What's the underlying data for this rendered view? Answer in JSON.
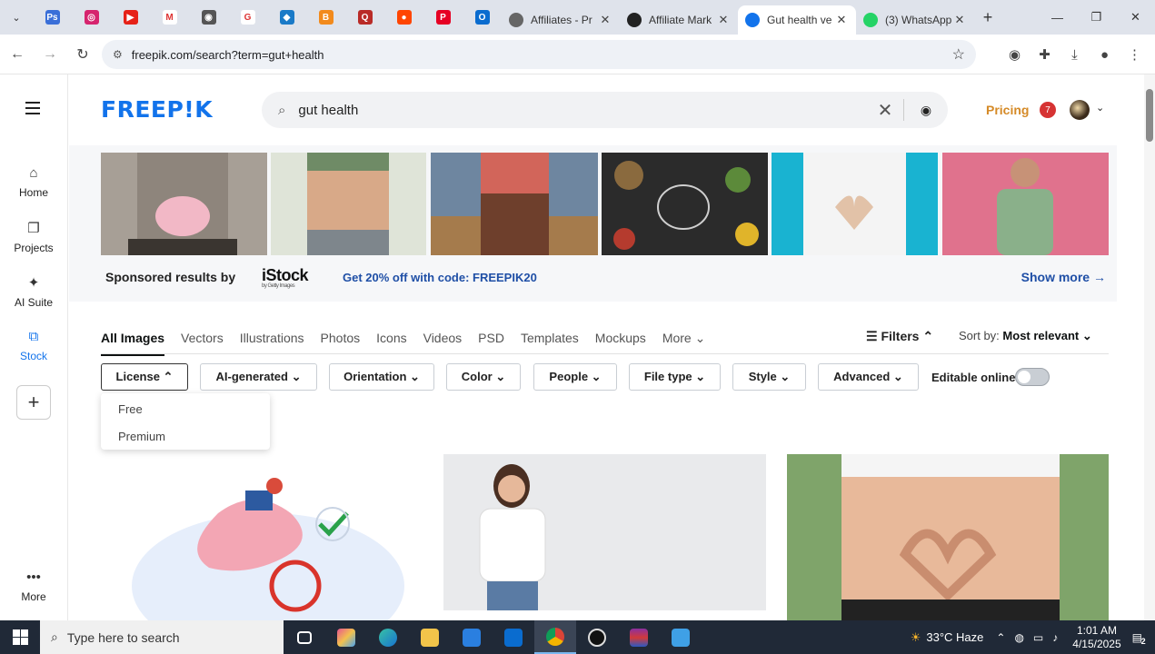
{
  "browser": {
    "pinned_tabs": [
      {
        "name": "tab-pinned-1",
        "color": "#3a6fd8",
        "glyph": "Ps"
      },
      {
        "name": "tab-pinned-instagram",
        "color": "#d6246e",
        "glyph": "◎"
      },
      {
        "name": "tab-pinned-youtube",
        "color": "#e62117",
        "glyph": "▶"
      },
      {
        "name": "tab-pinned-gmail",
        "color": "#ffffff",
        "glyph": "M"
      },
      {
        "name": "tab-pinned-5",
        "color": "#555555",
        "glyph": "◉"
      },
      {
        "name": "tab-pinned-google",
        "color": "#ffffff",
        "glyph": "G"
      },
      {
        "name": "tab-pinned-7",
        "color": "#1a7ac7",
        "glyph": "◆"
      },
      {
        "name": "tab-pinned-blogger",
        "color": "#f28a1c",
        "glyph": "B"
      },
      {
        "name": "tab-pinned-quora",
        "color": "#b92b27",
        "glyph": "Q"
      },
      {
        "name": "tab-pinned-reddit",
        "color": "#ff4500",
        "glyph": "●"
      },
      {
        "name": "tab-pinned-pinterest",
        "color": "#e60023",
        "glyph": "P"
      },
      {
        "name": "tab-pinned-outlook",
        "color": "#0a6ccf",
        "glyph": "O"
      }
    ],
    "tabs": [
      {
        "label": "Affiliates - Pr",
        "icon_color": "#666666",
        "active": false
      },
      {
        "label": "Affiliate Mark",
        "icon_color": "#222222",
        "active": false
      },
      {
        "label": "Gut health ve",
        "icon_color": "#1273eb",
        "active": true
      },
      {
        "label": "(3) WhatsApp",
        "icon_color": "#25d366",
        "active": false
      }
    ],
    "url": "freepik.com/search?term=gut+health"
  },
  "sidebar": {
    "items": [
      {
        "label": "Home",
        "icon": "home-icon",
        "glyph": "⌂"
      },
      {
        "label": "Projects",
        "icon": "folder-icon",
        "glyph": "❐"
      },
      {
        "label": "AI Suite",
        "icon": "sparkle-icon",
        "glyph": "✦"
      },
      {
        "label": "Stock",
        "icon": "stock-icon",
        "glyph": "⧉"
      }
    ],
    "more_label": "More"
  },
  "header": {
    "logo": "FREEP!K",
    "search_value": "gut health",
    "pricing": "Pricing",
    "notification_count": "7"
  },
  "sponsored": {
    "label": "Sponsored results by",
    "brand": "iStock",
    "brand_sub": "by Getty Images",
    "promo": "Get 20% off with code: FREEPIK20",
    "show_more": "Show more →"
  },
  "content_tabs": [
    "All Images",
    "Vectors",
    "Illustrations",
    "Photos",
    "Icons",
    "Videos",
    "PSD",
    "Templates",
    "Mockups",
    "More ⌄"
  ],
  "filters_label": "Filters ⌃",
  "sort": {
    "prefix": "Sort by:",
    "value": "Most relevant ⌄"
  },
  "filter_pills": [
    "License ⌃",
    "AI-generated ⌄",
    "Orientation ⌄",
    "Color ⌄",
    "People ⌄",
    "File type ⌄",
    "Style ⌄",
    "Advanced ⌄"
  ],
  "editable_online": "Editable online",
  "license_options": [
    "Free",
    "Premium"
  ],
  "taskbar": {
    "search_placeholder": "Type here to search",
    "weather": "33°C  Haze",
    "time": "1:01 AM",
    "date": "4/15/2025",
    "notification_count": "2"
  },
  "colors": {
    "brand": "#1273eb",
    "pricing": "#d58a27",
    "link": "#1f4fa6"
  }
}
